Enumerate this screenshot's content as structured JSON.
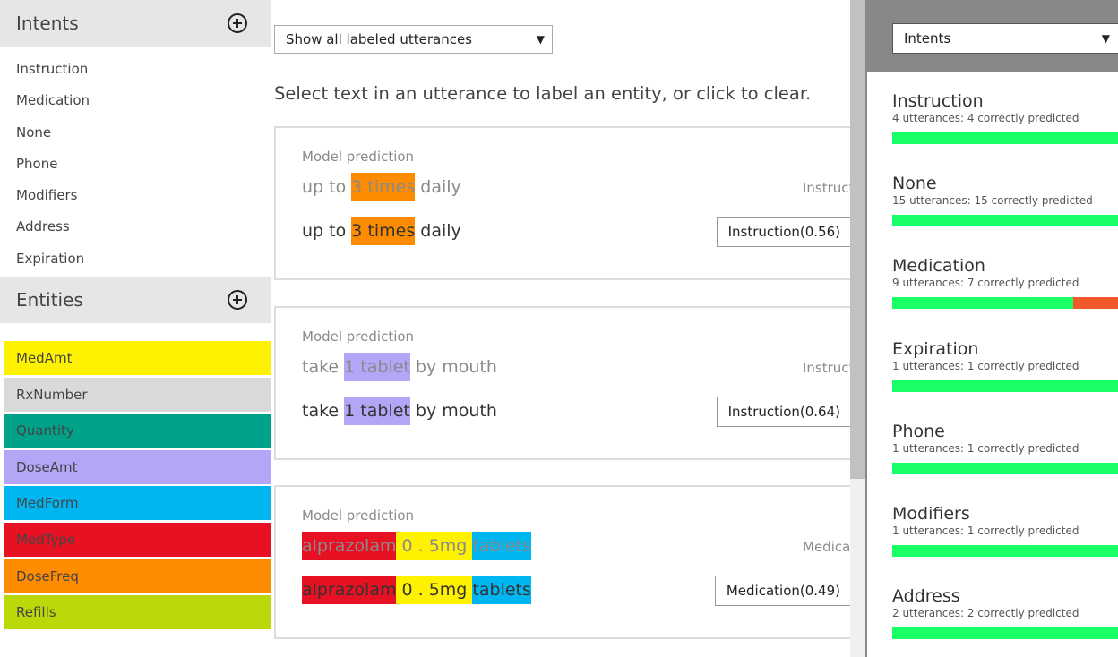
{
  "left": {
    "intents_title": "Intents",
    "intents": [
      "Instruction",
      "Medication",
      "None",
      "Phone",
      "Modifiers",
      "Address",
      "Expiration"
    ],
    "entities_title": "Entities",
    "entities": [
      {
        "label": "MedAmt",
        "color": "#fff200"
      },
      {
        "label": "RxNumber",
        "color": "#d9d9d9"
      },
      {
        "label": "Quantity",
        "color": "#00a38a"
      },
      {
        "label": "DoseAmt",
        "color": "#b4a5f7"
      },
      {
        "label": "MedForm",
        "color": "#00b6f0"
      },
      {
        "label": "MedType",
        "color": "#e81123"
      },
      {
        "label": "DoseFreq",
        "color": "#ff8c00"
      },
      {
        "label": "Refills",
        "color": "#bad80a"
      }
    ]
  },
  "center": {
    "view_select": "Show all labeled utterances",
    "instruction": "Select text in an utterance to label an entity, or click to clear.",
    "cards": [
      {
        "model_prediction_label": "Model prediction",
        "tokens": [
          {
            "text": "up to ",
            "color": ""
          },
          {
            "text": "3 times",
            "color": "#ff8c00"
          },
          {
            "text": " daily",
            "color": ""
          }
        ],
        "predicted_intent": "Instruct",
        "intent_button": "Instruction(0.56)"
      },
      {
        "model_prediction_label": "Model prediction",
        "tokens": [
          {
            "text": "take ",
            "color": ""
          },
          {
            "text": "1 tablet",
            "color": "#b4a5f7"
          },
          {
            "text": " by mouth",
            "color": ""
          }
        ],
        "predicted_intent": "Instruct",
        "intent_button": "Instruction(0.64)"
      },
      {
        "model_prediction_label": "Model prediction",
        "tokens": [
          {
            "text": "alprazolam",
            "color": "#e81123"
          },
          {
            "text": " 0 . 5mg ",
            "color": "#fff200"
          },
          {
            "text": "tablets",
            "color": "#00b6f0"
          }
        ],
        "predicted_intent": "Medicat",
        "intent_button": "Medication(0.49)"
      }
    ]
  },
  "right": {
    "select": "Intents",
    "stats": [
      {
        "name": "Instruction",
        "summary": "4 utterances: 4 correctly predicted",
        "correct_fraction": 1.0
      },
      {
        "name": "None",
        "summary": "15 utterances: 15 correctly predicted",
        "correct_fraction": 1.0
      },
      {
        "name": "Medication",
        "summary": "9 utterances: 7 correctly predicted",
        "correct_fraction": 0.778
      },
      {
        "name": "Expiration",
        "summary": "1 utterances: 1 correctly predicted",
        "correct_fraction": 1.0
      },
      {
        "name": "Phone",
        "summary": "1 utterances: 1 correctly predicted",
        "correct_fraction": 1.0
      },
      {
        "name": "Modifiers",
        "summary": "1 utterances: 1 correctly predicted",
        "correct_fraction": 1.0
      },
      {
        "name": "Address",
        "summary": "2 utterances: 2 correctly predicted",
        "correct_fraction": 1.0
      }
    ]
  }
}
